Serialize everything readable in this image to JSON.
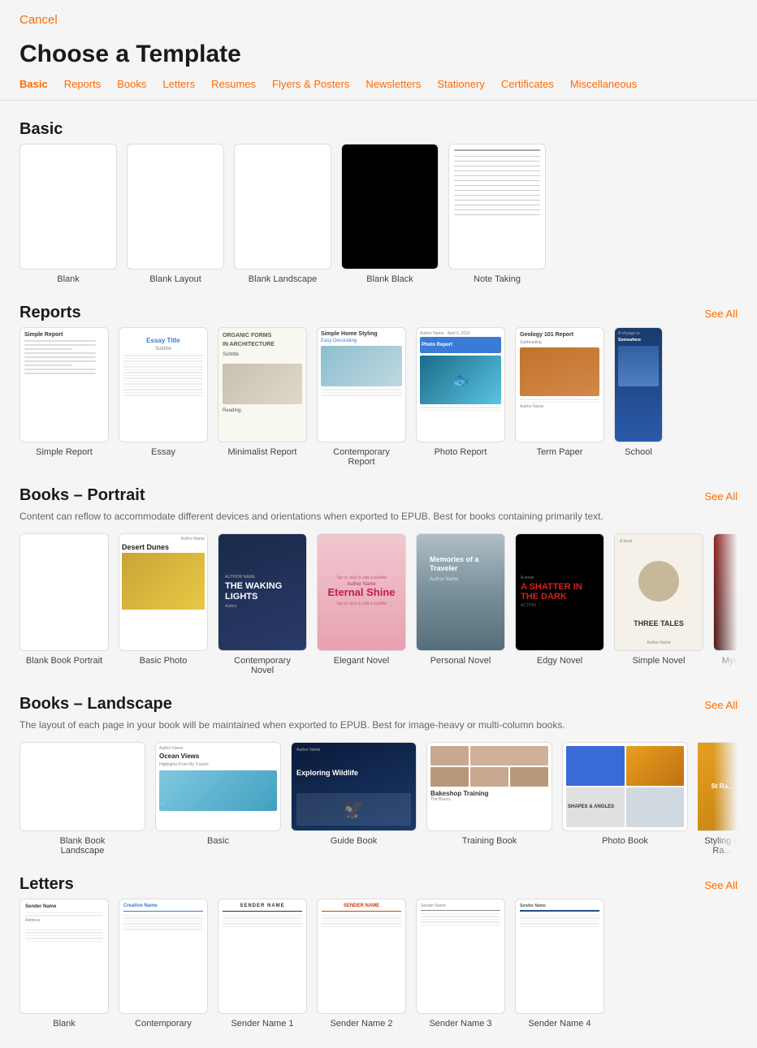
{
  "header": {
    "cancel_label": "Cancel",
    "title": "Choose a Template"
  },
  "nav": {
    "tabs": [
      {
        "label": "Basic",
        "active": true
      },
      {
        "label": "Reports"
      },
      {
        "label": "Books"
      },
      {
        "label": "Letters"
      },
      {
        "label": "Resumes"
      },
      {
        "label": "Flyers & Posters"
      },
      {
        "label": "Newsletters"
      },
      {
        "label": "Stationery"
      },
      {
        "label": "Certificates"
      },
      {
        "label": "Miscellaneous"
      }
    ]
  },
  "sections": {
    "basic": {
      "title": "Basic",
      "items": [
        {
          "label": "Blank"
        },
        {
          "label": "Blank Layout"
        },
        {
          "label": "Blank Landscape"
        },
        {
          "label": "Blank Black"
        },
        {
          "label": "Note Taking"
        }
      ]
    },
    "reports": {
      "title": "Reports",
      "see_all": "See All",
      "items": [
        {
          "label": "Simple Report"
        },
        {
          "label": "Essay"
        },
        {
          "label": "Minimalist Report"
        },
        {
          "label": "Contemporary Report"
        },
        {
          "label": "Photo Report"
        },
        {
          "label": "Term Paper"
        },
        {
          "label": "School"
        }
      ]
    },
    "books_portrait": {
      "title": "Books – Portrait",
      "see_all": "See All",
      "description": "Content can reflow to accommodate different devices and orientations when exported to EPUB. Best for books containing primarily text.",
      "items": [
        {
          "label": "Blank Book Portrait"
        },
        {
          "label": "Basic Photo"
        },
        {
          "label": "Contemporary Novel"
        },
        {
          "label": "Elegant Novel"
        },
        {
          "label": "Personal Novel"
        },
        {
          "label": "Edgy Novel"
        },
        {
          "label": "Simple Novel"
        },
        {
          "label": "Mystery"
        }
      ]
    },
    "books_landscape": {
      "title": "Books – Landscape",
      "see_all": "See All",
      "description": "The layout of each page in your book will be maintained when exported to EPUB. Best for image-heavy or multi-column books.",
      "items": [
        {
          "label": "Blank Book Landscape"
        },
        {
          "label": "Basic"
        },
        {
          "label": "Guide Book"
        },
        {
          "label": "Training Book"
        },
        {
          "label": "Photo Book"
        },
        {
          "label": "Styling & Ra..."
        }
      ]
    },
    "letters": {
      "title": "Letters",
      "see_all": "See All",
      "items": [
        {
          "label": "Blank"
        },
        {
          "label": "Contemporary"
        },
        {
          "label": "Sender Name 1"
        },
        {
          "label": "Sender Name 2"
        },
        {
          "label": "Sender Name 3"
        },
        {
          "label": "Sender Name 4"
        }
      ]
    }
  },
  "book_content": {
    "desert_dunes_author": "Author Name",
    "desert_dunes_title": "Desert Dunes",
    "waking_lights_title": "THE WAKING LIGHTS",
    "eternal_shine_title": "Eternal Shine",
    "eternal_shine_author": "Author Name",
    "memories_title": "Memories of a Traveler",
    "memories_author": "Author Name",
    "edgy_title": "A SHATTER IN THE DARK",
    "three_tales_title": "THREE TALES",
    "ocean_views_title": "Ocean Views",
    "ocean_views_sub": "Highlights From My Travels",
    "exploring_wildlife": "Exploring Wildlife",
    "bakeshop_title": "Bakeshop Training",
    "bakeshop_sub": "The Basics",
    "shapes_angles": "SHAPES & ANGLES"
  }
}
